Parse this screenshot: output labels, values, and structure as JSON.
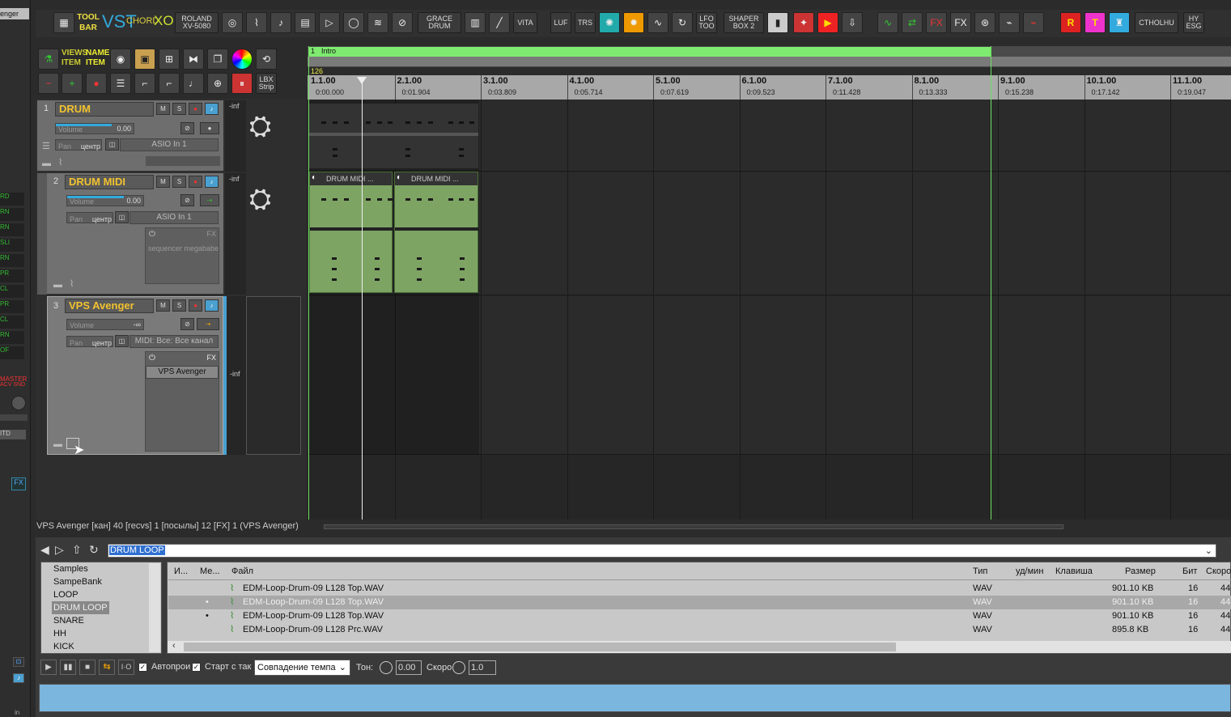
{
  "toolbar": {
    "buttons": [
      {
        "label": "TOOL BAR"
      },
      {
        "label": "VST"
      },
      {
        "label": "CHORD"
      },
      {
        "label": "XO"
      },
      {
        "label": "ROLAND XV-5080"
      },
      {
        "label": "GRACE DRUM"
      },
      {
        "label": "VITA"
      },
      {
        "label": "LUF"
      },
      {
        "label": "TRS"
      },
      {
        "label": "LFO TOO"
      },
      {
        "label": "SHAPER BOX 2"
      },
      {
        "label": "CTHOLHU"
      },
      {
        "label": "HY ESG"
      },
      {
        "label": "VIEWS ITEM"
      },
      {
        "label": "NAME ITEM"
      },
      {
        "label": "LBX Strip"
      }
    ]
  },
  "left_strip": {
    "top_label": "enger",
    "master_label": "MASTER",
    "master_sub": "ACV SND",
    "knob_labels": [
      "RD",
      "RN",
      "RN",
      "SLI",
      "RN",
      "PR",
      "CL",
      "PR",
      "CL",
      "RN",
      "OF"
    ],
    "itd": "ITD",
    "fx": "FX",
    "in": "in"
  },
  "timeline": {
    "region_name": "Intro",
    "region_num": "1",
    "tempo": "126",
    "markers": [
      {
        "bar": "1.1.00",
        "time": "0:00.000"
      },
      {
        "bar": "2.1.00",
        "time": "0:01.904"
      },
      {
        "bar": "3.1.00",
        "time": "0:03.809"
      },
      {
        "bar": "4.1.00",
        "time": "0:05.714"
      },
      {
        "bar": "5.1.00",
        "time": "0:07.619"
      },
      {
        "bar": "6.1.00",
        "time": "0:09.523"
      },
      {
        "bar": "7.1.00",
        "time": "0:11.428"
      },
      {
        "bar": "8.1.00",
        "time": "0:13.333"
      },
      {
        "bar": "9.1.00",
        "time": "0:15.238"
      },
      {
        "bar": "10.1.00",
        "time": "0:17.142"
      },
      {
        "bar": "11.1.00",
        "time": "0:19.047"
      }
    ]
  },
  "tracks": [
    {
      "num": "1",
      "name": "DRUM",
      "volume_label": "Volume",
      "volume_value": "0.00",
      "pan_label": "Pan",
      "pan_value": "центр",
      "input": "ASIO In 1",
      "meter": "-inf",
      "mute": "M",
      "solo": "S"
    },
    {
      "num": "2",
      "name": "DRUM MIDI",
      "volume_label": "Volume",
      "volume_value": "0.00",
      "pan_label": "Pan",
      "pan_value": "центр",
      "input": "ASIO In 1",
      "meter": "-inf",
      "fx_label": "FX",
      "fx_plugin": "sequencer megababe",
      "items": [
        "DRUM MIDI ...",
        "DRUM MIDI ..."
      ],
      "mute": "M",
      "solo": "S"
    },
    {
      "num": "3",
      "name": "VPS Avenger",
      "volume_label": "Volume",
      "volume_value": "-∞",
      "pan_label": "Pan",
      "pan_value": "центр",
      "input": "MIDI: Все: Все канал",
      "meter": "-inf",
      "fx_label": "FX",
      "fx_plugin": "VPS Avenger",
      "mute": "M",
      "solo": "S"
    }
  ],
  "status_bar": "VPS Avenger [кан] 40 [recvs] 1 [посылы] 12 [FX] 1 (VPS Avenger)",
  "browser": {
    "path": "DRUM LOOP",
    "folders": [
      "Samples",
      "SampeBank",
      "LOOP",
      "DRUM LOOP",
      "SNARE",
      "HH",
      "KICK"
    ],
    "selected_folder": "DRUM LOOP",
    "columns": [
      "И...",
      "Ме...",
      "Файл",
      "Тип",
      "уд/мин",
      "Клавиша",
      "Размер",
      "Бит",
      "Скоро"
    ],
    "files": [
      {
        "name": "EDM-Loop-Drum-09 L128 Top.WAV",
        "type": "WAV",
        "size": "901.10 KB",
        "bits": "16",
        "rate": "44",
        "mark": ""
      },
      {
        "name": "EDM-Loop-Drum-09 L128 Top.WAV",
        "type": "WAV",
        "size": "901.10 KB",
        "bits": "16",
        "rate": "44",
        "mark": "•"
      },
      {
        "name": "EDM-Loop-Drum-09 L128 Top.WAV",
        "type": "WAV",
        "size": "901.10 KB",
        "bits": "16",
        "rate": "44",
        "mark": "•"
      },
      {
        "name": "EDM-Loop-Drum-09 L128 Prc.WAV",
        "type": "WAV",
        "size": "895.8 KB",
        "bits": "16",
        "rate": "44",
        "mark": ""
      }
    ],
    "autoplay": "Автопрои",
    "start_on_bar": "Старт с так",
    "tempo_match": "Совпадение темпа",
    "pitch_label": "Тон:",
    "pitch_value": "0.00",
    "rate_label": "Скоро",
    "rate_value": "1.0"
  }
}
